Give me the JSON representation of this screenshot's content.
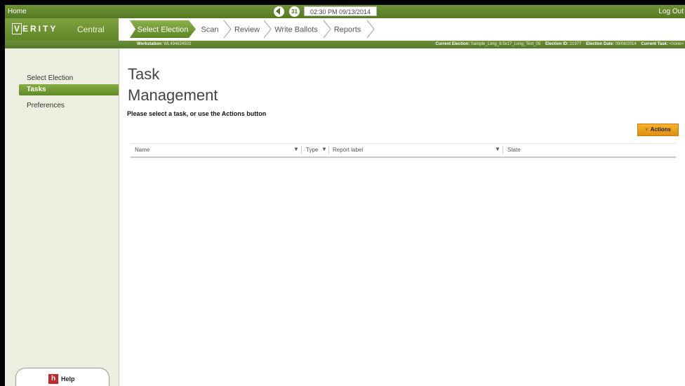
{
  "topbar": {
    "home": "Home",
    "datetime": "02:30 PM 09/13/2014",
    "logout": "Log Out",
    "calendar_glyph": "31"
  },
  "brand": {
    "name": "VERITY",
    "first_letter": "V",
    "rest": "ERITY",
    "product": "Central"
  },
  "steps": [
    "Select Election",
    "Scan",
    "Review",
    "Write Ballots",
    "Reports"
  ],
  "infobar": {
    "workstation_label": "Workstation:",
    "workstation_value": "WL494824503",
    "current_election_label": "Current Election:",
    "current_election_value": "Sample_Long_8.5x17_Long_Text_05",
    "election_id_label": "Election ID:",
    "election_id_value": "21977",
    "election_date_label": "Election Date:",
    "election_date_value": "09/08/2014",
    "current_task_label": "Current Task:",
    "current_task_value": "<none>"
  },
  "sidebar": {
    "items": [
      "Select Election",
      "Tasks",
      "Preferences"
    ],
    "help": "Help",
    "help_glyph": "h"
  },
  "main": {
    "title_line1": "Task",
    "title_line2": "Management",
    "instruction": "Please select a task, or use the Actions button",
    "actions_label": "Actions",
    "actions_chevron": "˅",
    "filter_glyph": "▼",
    "columns": [
      "Name",
      "Type",
      "Report label",
      "State"
    ]
  },
  "colors": {
    "accent_green": "#6a9130",
    "actions_orange": "#f0a21e",
    "help_red": "#c0282d"
  }
}
